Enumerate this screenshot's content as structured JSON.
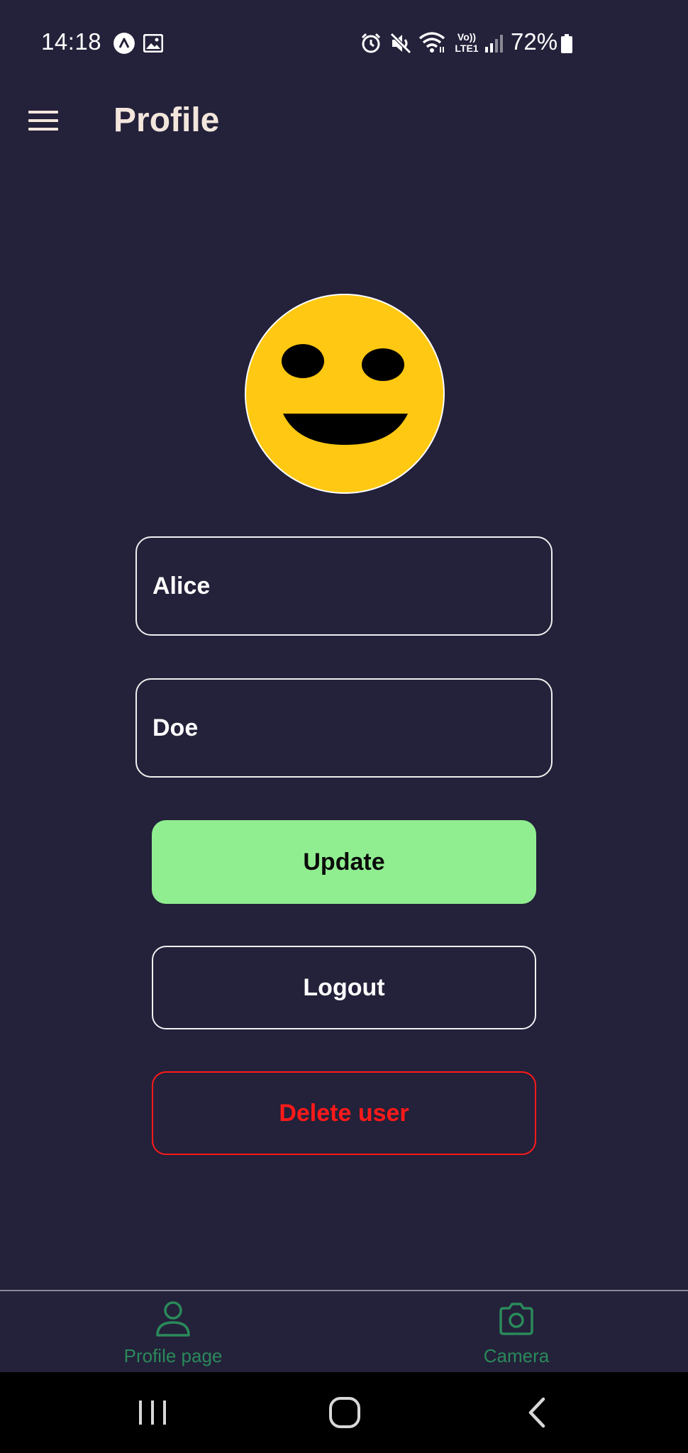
{
  "status_bar": {
    "time": "14:18",
    "battery_percent": "72%",
    "network_label": "Vo)) LTE1",
    "icons": [
      "app-notification-icon",
      "gallery-icon",
      "alarm-icon",
      "mute-icon",
      "wifi-icon",
      "lte-icon",
      "signal-icon",
      "battery-icon"
    ]
  },
  "app_bar": {
    "title": "Profile",
    "menu_icon": "hamburger-menu-icon"
  },
  "profile": {
    "avatar_icon": "smiley-face-avatar",
    "avatar_color": "#ffc812",
    "first_name_value": "Alice",
    "last_name_value": "Doe"
  },
  "actions": {
    "update_label": "Update",
    "logout_label": "Logout",
    "delete_label": "Delete user",
    "update_color": "#90ee90",
    "delete_color": "#ff1a1a"
  },
  "bottom_nav": {
    "items": [
      {
        "label": "Profile page",
        "icon": "person-icon"
      },
      {
        "label": "Camera",
        "icon": "camera-icon"
      }
    ],
    "accent_color": "#2a8a5a"
  },
  "system_nav": {
    "buttons": [
      "recent-apps-icon",
      "home-icon",
      "back-icon"
    ]
  },
  "colors": {
    "background": "#24213a"
  }
}
